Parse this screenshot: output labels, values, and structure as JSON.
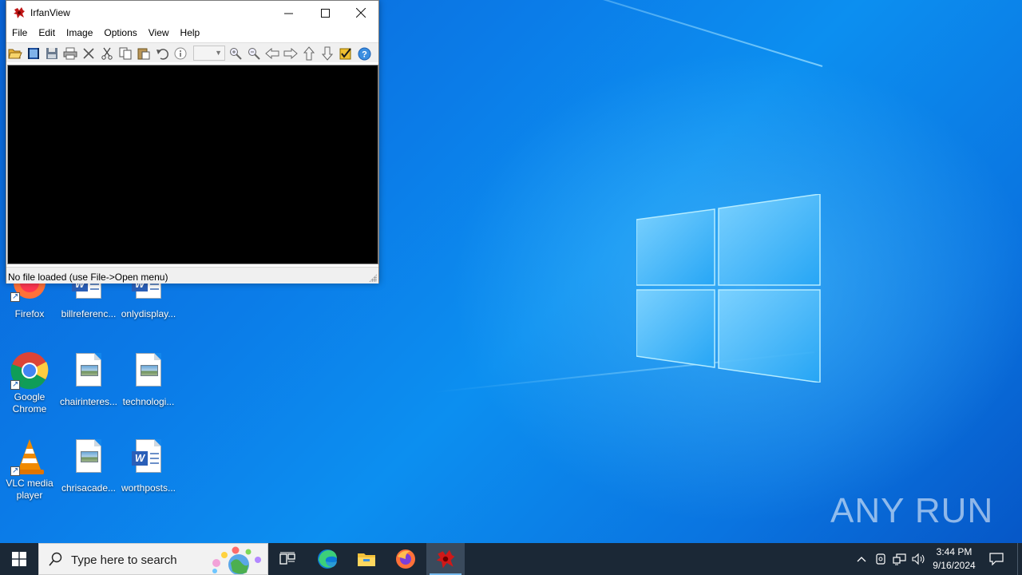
{
  "window": {
    "title": "IrfanView",
    "menu": [
      "File",
      "Edit",
      "Image",
      "Options",
      "View",
      "Help"
    ],
    "toolbar_icons": [
      "open-folder-icon",
      "slideshow-icon",
      "save-icon",
      "print-icon",
      "delete-icon",
      "cut-icon",
      "copy-icon",
      "paste-icon",
      "undo-icon",
      "info-icon",
      "zoom-in-icon",
      "zoom-out-icon",
      "previous-icon",
      "next-icon",
      "first-icon",
      "last-icon",
      "properties-icon",
      "help-icon"
    ],
    "zoom_value": "",
    "status": "No file loaded (use File->Open menu)"
  },
  "desktop_icons": [
    {
      "label": "Firefox",
      "icon": "firefox-icon"
    },
    {
      "label": "billreferenc...",
      "icon": "word-doc-icon"
    },
    {
      "label": "onlydisplay...",
      "icon": "word-doc-icon"
    },
    {
      "label": "Google Chrome",
      "icon": "chrome-icon"
    },
    {
      "label": "chairinteres...",
      "icon": "image-file-icon"
    },
    {
      "label": "technologi...",
      "icon": "image-file-icon"
    },
    {
      "label": "VLC media player",
      "icon": "vlc-icon"
    },
    {
      "label": "chrisacade...",
      "icon": "image-file-icon"
    },
    {
      "label": "worthposts...",
      "icon": "word-doc-icon"
    }
  ],
  "taskbar": {
    "search_placeholder": "Type here to search",
    "apps": [
      "start-icon",
      "task-view-icon",
      "edge-icon",
      "file-explorer-icon",
      "firefox-icon",
      "irfanview-icon"
    ],
    "time": "3:44 PM",
    "date": "9/16/2024"
  },
  "watermark": "ANY RUN",
  "colors": {
    "taskbar": "#1b2836",
    "desktop": "#0b7ce8",
    "viewport": "#000000"
  }
}
